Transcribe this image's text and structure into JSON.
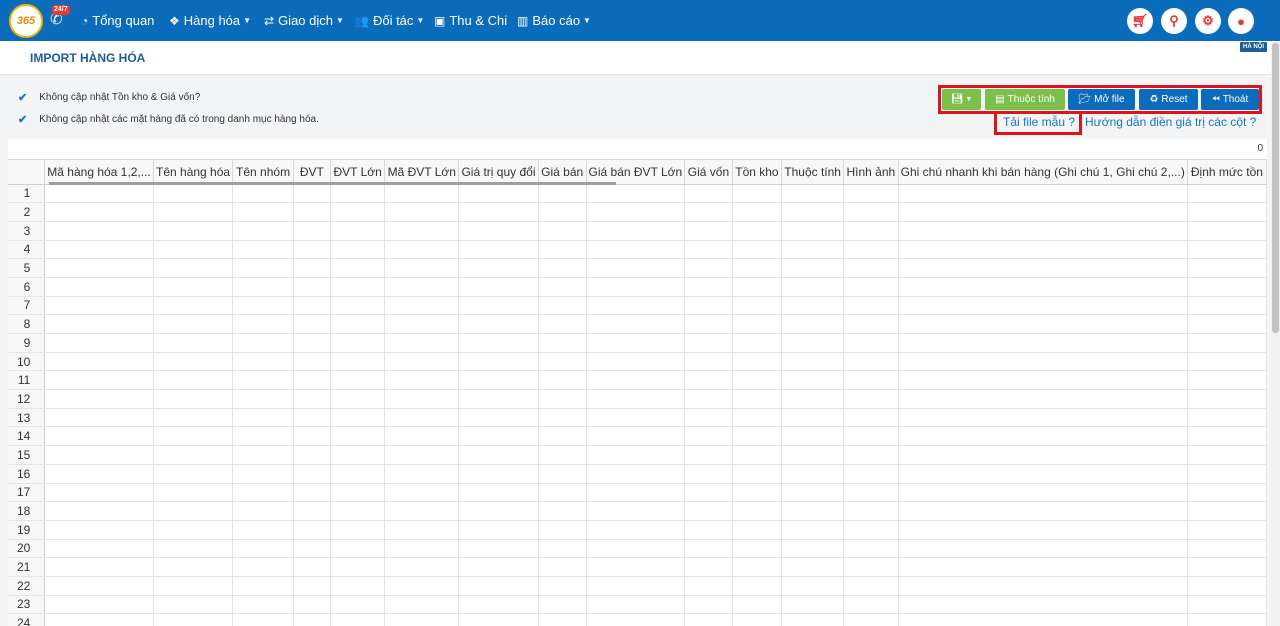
{
  "nav": {
    "logo_text": "365",
    "support_badge": "24/7",
    "items": [
      {
        "label": "Tổng quan",
        "icon": "dashboard-icon",
        "glyph": "◔",
        "caret": false
      },
      {
        "label": "Hàng hóa",
        "icon": "boxes-icon",
        "glyph": "❖",
        "caret": true
      },
      {
        "label": "Giao dịch",
        "icon": "exchange-icon",
        "glyph": "⇄",
        "caret": true
      },
      {
        "label": "Đối tác",
        "icon": "users-icon",
        "glyph": "👥",
        "caret": true
      },
      {
        "label": "Thu & Chi",
        "icon": "money-icon",
        "glyph": "▣",
        "caret": false
      },
      {
        "label": "Báo cáo",
        "icon": "bar-chart-icon",
        "glyph": "▥",
        "caret": true
      }
    ],
    "right_icons": [
      "cart-icon",
      "location-icon",
      "gear-icon",
      "user-icon"
    ]
  },
  "page": {
    "title": "IMPORT HÀNG HÓA",
    "location_badge": "HÀ NỘI"
  },
  "options": [
    "Không cập nhật Tồn kho & Giá vốn?",
    "Không cập nhật các mặt hàng đã có trong danh mục hàng hóa."
  ],
  "toolbar": {
    "thuoc_tinh": "Thuộc tính",
    "mo_file": "Mở file",
    "reset": "Reset",
    "thoat": "Thoát"
  },
  "links": {
    "tai_file_mau": "Tải file mẫu ?",
    "huong_dan": "Hướng dẫn điền giá trị các cột ?"
  },
  "grid": {
    "count": "0",
    "columns": [
      "Mã hàng hóa 1,2,...",
      "Tên hàng hóa",
      "Tên nhóm",
      "ĐVT",
      "ĐVT Lớn",
      "Mã ĐVT Lớn",
      "Giá trị quy đổi",
      "Giá bán",
      "Giá bán ĐVT Lớn",
      "Giá vốn",
      "Tồn kho",
      "Thuộc tính",
      "Hình ảnh",
      "Ghi chú nhanh khi bán hàng (Ghi chú 1, Ghi chú 2,...)",
      "Định mức tồn"
    ],
    "row_numbers": [
      "1",
      "2",
      "3",
      "4",
      "5",
      "6",
      "7",
      "8",
      "9",
      "10",
      "11",
      "12",
      "13",
      "14",
      "15",
      "16",
      "17",
      "18",
      "19",
      "20",
      "21",
      "22",
      "23",
      "24"
    ]
  },
  "colors": {
    "nav_bg": "#0a6cbb",
    "green_button": "#7cc04b",
    "highlight_border": "#e0121b"
  }
}
